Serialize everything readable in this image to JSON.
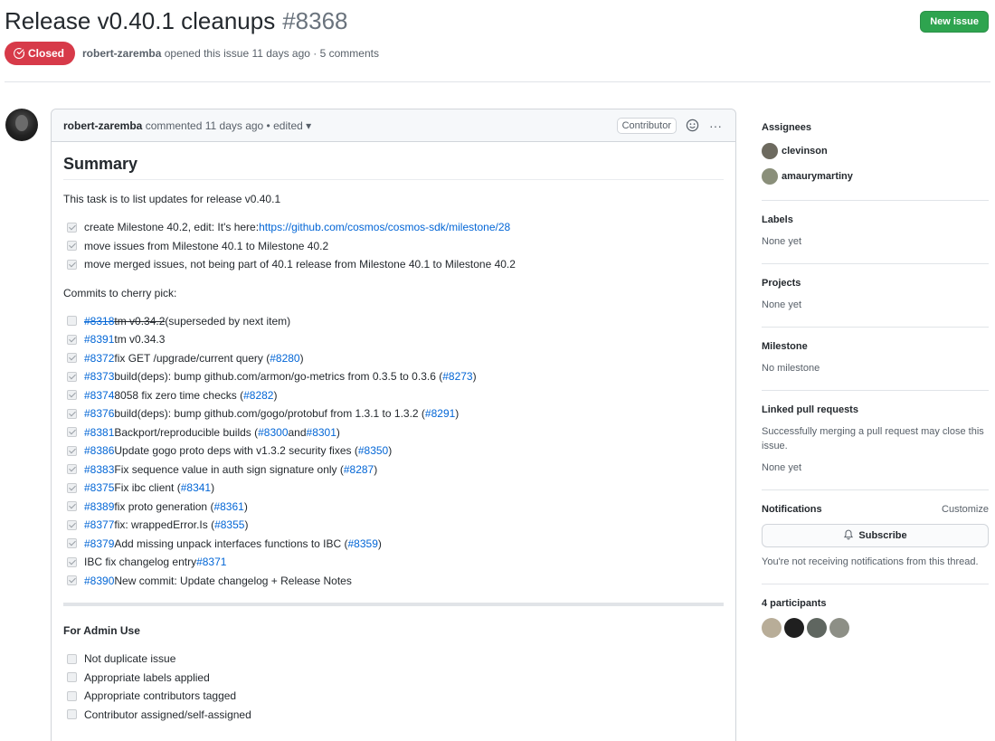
{
  "issue": {
    "title": "Release v0.40.1 cleanups",
    "number": "#8368",
    "state": "Closed",
    "author": "robert-zaremba",
    "meta_suffix": "opened this issue 11 days ago · 5 comments",
    "new_issue_label": "New issue"
  },
  "comment": {
    "author": "robert-zaremba",
    "meta": "commented 11 days ago • edited",
    "role": "Contributor",
    "summary_heading": "Summary",
    "intro": "This task is to list updates for release v0.40.1",
    "tasks": [
      {
        "text": "create Milestone 40.2, edit: It's here: ",
        "link": "https://github.com/cosmos/cosmos-sdk/milestone/28"
      },
      {
        "text": "move issues from Milestone 40.1 to Milestone 40.2"
      },
      {
        "text": "move merged issues, not being part of 40.1 release from Milestone 40.1 to Milestone 40.2"
      }
    ],
    "commits_heading": "Commits to cherry pick:",
    "commits": [
      {
        "pr": "#8318",
        "strike": "tm v0.34.2",
        "text": " (superseded by next item)",
        "checked": false
      },
      {
        "pr": "#8391",
        "text": " tm v0.34.3",
        "checked": true
      },
      {
        "pr": "#8372",
        "text": " fix GET /upgrade/current query (",
        "ref": "#8280",
        "after": ")",
        "checked": true
      },
      {
        "pr": "#8373",
        "text": " build(deps): bump github.com/armon/go-metrics from 0.3.5 to 0.3.6 (",
        "ref": "#8273",
        "after": ")",
        "checked": true
      },
      {
        "pr": "#8374",
        "text": " 8058 fix zero time checks (",
        "ref": "#8282",
        "after": ")",
        "checked": true
      },
      {
        "pr": "#8376",
        "text": " build(deps): bump github.com/gogo/protobuf from 1.3.1 to 1.3.2 (",
        "ref": "#8291",
        "after": ")",
        "checked": true
      },
      {
        "pr": "#8381",
        "text": " Backport/reproducible builds (",
        "ref": "#8300",
        "mid": " and ",
        "ref2": "#8301",
        "after": ")",
        "checked": true
      },
      {
        "pr": "#8386",
        "text": " Update gogo proto deps with v1.3.2 security fixes (",
        "ref": "#8350",
        "after": ")",
        "checked": true
      },
      {
        "pr": "#8383",
        "text": " Fix sequence value in auth sign signature only (",
        "ref": "#8287",
        "after": ")",
        "checked": true
      },
      {
        "pr": "#8375",
        "text": " Fix ibc client (",
        "ref": "#8341",
        "after": ")",
        "checked": true
      },
      {
        "pr": "#8389",
        "text": " fix proto generation (",
        "ref": "#8361",
        "after": ")",
        "checked": true
      },
      {
        "pr": "#8377",
        "text": " fix: wrappedError.Is (",
        "ref": "#8355",
        "after": ")",
        "checked": true
      },
      {
        "pr": "#8379",
        "text": " Add missing unpack interfaces functions to IBC (",
        "ref": "#8359",
        "after": ")",
        "checked": true
      },
      {
        "pr": "",
        "text": "IBC fix changelog entry ",
        "ref": "#8371",
        "after": "",
        "checked": true
      },
      {
        "pr": "#8390",
        "text": " New commit: Update changelog + Release Notes",
        "checked": true
      }
    ],
    "admin_heading": "For Admin Use",
    "admin_tasks": [
      "Not duplicate issue",
      "Appropriate labels applied",
      "Appropriate contributors tagged",
      "Contributor assigned/self-assigned"
    ]
  },
  "sidebar": {
    "assignees_heading": "Assignees",
    "assignees": [
      {
        "name": "clevinson",
        "color": "#6d6a5f"
      },
      {
        "name": "amaurymartiny",
        "color": "#8a8f7a"
      }
    ],
    "labels_heading": "Labels",
    "labels_value": "None yet",
    "projects_heading": "Projects",
    "projects_value": "None yet",
    "milestone_heading": "Milestone",
    "milestone_value": "No milestone",
    "linked_heading": "Linked pull requests",
    "linked_desc": "Successfully merging a pull request may close this issue.",
    "linked_value": "None yet",
    "notifications_heading": "Notifications",
    "customize_label": "Customize",
    "subscribe_label": "Subscribe",
    "notify_desc": "You're not receiving notifications from this thread.",
    "participants_heading": "4 participants",
    "participant_colors": [
      "#b8ad98",
      "#1f1f1f",
      "#5f6660",
      "#8d8f86"
    ]
  },
  "colors": {
    "closed": "#d73a49",
    "new_issue": "#2ea44f",
    "link": "#0366d6"
  }
}
